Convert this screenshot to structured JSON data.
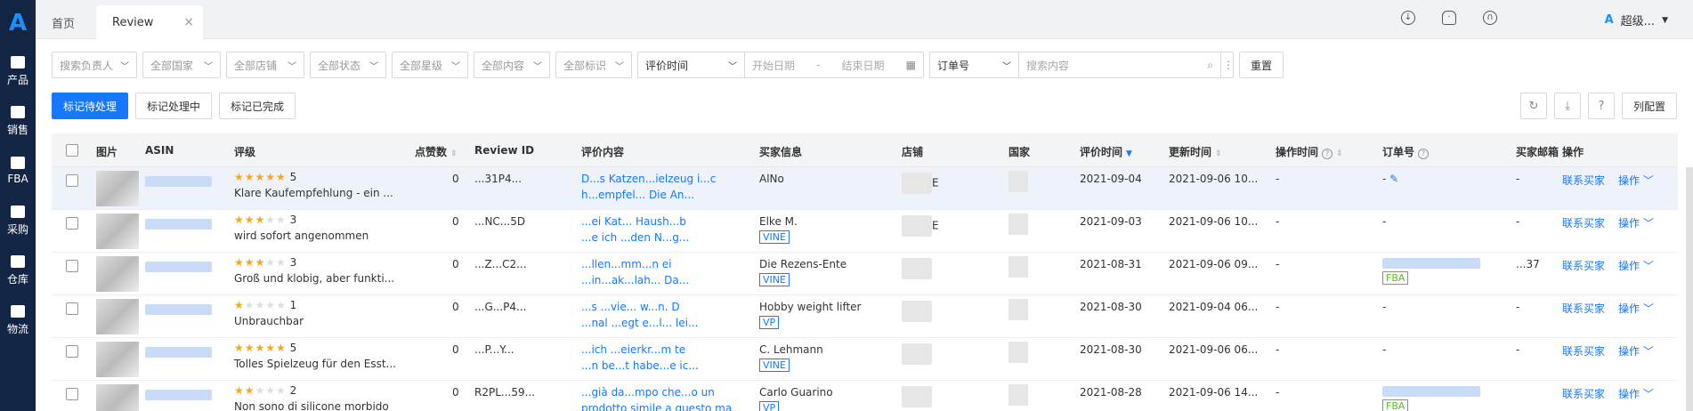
{
  "sidebar": {
    "logo": "A",
    "items": [
      {
        "label": "产品",
        "icon": "box-icon"
      },
      {
        "label": "销售",
        "icon": "sell-icon"
      },
      {
        "label": "FBA",
        "icon": "amazon-icon"
      },
      {
        "label": "采购",
        "icon": "cart-icon"
      },
      {
        "label": "仓库",
        "icon": "warehouse-icon"
      },
      {
        "label": "物流",
        "icon": "truck-icon"
      }
    ]
  },
  "tabs": {
    "home": "首页",
    "active": "Review",
    "close": "×"
  },
  "user": {
    "logo": "A",
    "name": "超级..."
  },
  "filters": {
    "owner": "搜索负责人",
    "country": "全部国家",
    "shop": "全部店铺",
    "status": "全部状态",
    "rating": "全部星级",
    "content": "全部内容",
    "mark": "全部标识",
    "date_type": "评价时间",
    "start": "开始日期",
    "sep": "-",
    "end": "结束日期",
    "order_type": "订单号",
    "search_ph": "搜索内容",
    "reset": "重置"
  },
  "actions": {
    "pending": "标记待处理",
    "processing": "标记处理中",
    "done": "标记已完成",
    "config": "列配置"
  },
  "columns": {
    "image": "图片",
    "asin": "ASIN",
    "rating": "评级",
    "likes": "点赞数",
    "review_id": "Review ID",
    "content": "评价内容",
    "buyer": "买家信息",
    "shop": "店铺",
    "country": "国家",
    "review_time": "评价时间",
    "update_time": "更新时间",
    "op_time": "操作时间",
    "order": "订单号",
    "email": "买家邮箱",
    "ops": "操作"
  },
  "rows": [
    {
      "stars": 5,
      "score": "5",
      "title": "Klare Kaufempfehlung - ein ...",
      "likes": "0",
      "rid": "...31P4...",
      "content1": "D...s Katzen...ielzeug i...c",
      "content2": "h...empfel... Die An...",
      "buyer": "AlNo",
      "tag": "",
      "shop": "E",
      "review_time": "2021-09-04",
      "update_time": "2021-09-06 10...",
      "op_time": "-",
      "order": "- ",
      "email": "-",
      "contact": "联系买家",
      "op": "操作"
    },
    {
      "stars": 3,
      "score": "3",
      "title": "wird sofort angenommen",
      "likes": "0",
      "rid": "...NC...5D",
      "content1": "...ei Kat... Haush...b",
      "content2": "...e ich ...den N...g...",
      "buyer": "Elke M.",
      "tag": "VINE",
      "shop": "E",
      "review_time": "2021-09-03",
      "update_time": "2021-09-06 10...",
      "op_time": "-",
      "order": "-",
      "email": "-",
      "contact": "联系买家",
      "op": "操作"
    },
    {
      "stars": 3,
      "score": "3",
      "title": "Groß und klobig, aber funkti...",
      "likes": "0",
      "rid": "...Z...C2...",
      "content1": "...llen...mm...n ei",
      "content2": "...in...ak...lah... Da...",
      "buyer": "Die Rezens-Ente",
      "tag": "VINE",
      "shop": "",
      "review_time": "2021-08-31",
      "update_time": "2021-09-06 09...",
      "op_time": "-",
      "order": "",
      "order_tag": "FBA",
      "email": "...37",
      "contact": "联系买家",
      "op": "操作"
    },
    {
      "stars": 1,
      "score": "1",
      "title": "Unbrauchbar",
      "likes": "0",
      "rid": "...G...P4...",
      "content1": "...s ...vie... w...n. D",
      "content2": "...nal ...egt e...l... lei...",
      "buyer": "Hobby weight lifter",
      "tag": "VP",
      "shop": "",
      "review_time": "2021-08-30",
      "update_time": "2021-09-04 06...",
      "op_time": "-",
      "order": "-",
      "email": "-",
      "contact": "联系买家",
      "op": "操作"
    },
    {
      "stars": 5,
      "score": "5",
      "title": "Tolles Spielzeug für den Esst...",
      "likes": "0",
      "rid": "...P...Y...",
      "content1": "...ich ...eierkr...m te",
      "content2": "...n be...t habe...e ic...",
      "buyer": "C. Lehmann",
      "tag": "VINE",
      "shop": "",
      "review_time": "2021-08-30",
      "update_time": "2021-09-06 06...",
      "op_time": "-",
      "order": "-",
      "email": "-",
      "contact": "联系买家",
      "op": "操作"
    },
    {
      "stars": 2,
      "score": "2",
      "title": "Non sono di silicone morbido",
      "likes": "0",
      "rid": "R2PL...59...",
      "content1": "...già da...mpo che...o un",
      "content2": "prodotto simile a questo ma",
      "buyer": "Carlo Guarino",
      "tag": "VP",
      "shop": "",
      "review_time": "2021-08-28",
      "update_time": "2021-09-06 14...",
      "op_time": "-",
      "order": "",
      "order_tag": "FBA",
      "email": "",
      "contact": "联系买家",
      "op": "操作"
    }
  ]
}
